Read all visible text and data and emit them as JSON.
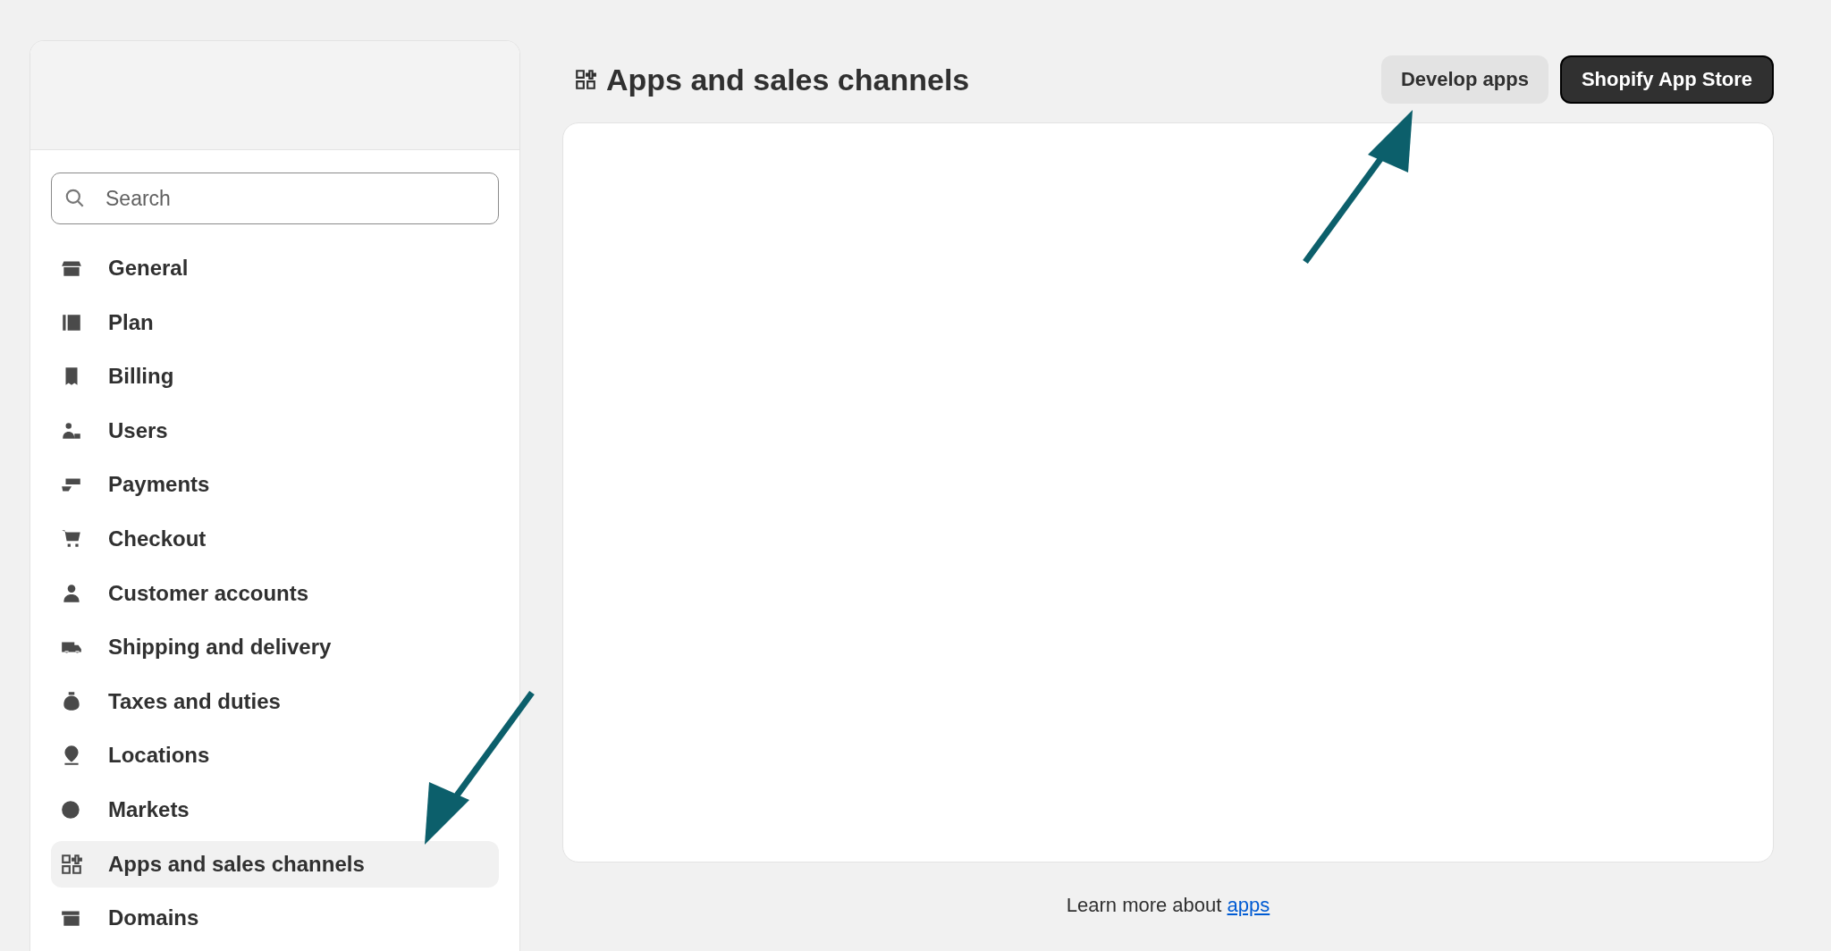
{
  "sidebar": {
    "search": {
      "placeholder": "Search"
    },
    "items": [
      {
        "label": "General",
        "selected": false
      },
      {
        "label": "Plan",
        "selected": false
      },
      {
        "label": "Billing",
        "selected": false
      },
      {
        "label": "Users",
        "selected": false
      },
      {
        "label": "Payments",
        "selected": false
      },
      {
        "label": "Checkout",
        "selected": false
      },
      {
        "label": "Customer accounts",
        "selected": false
      },
      {
        "label": "Shipping and delivery",
        "selected": false
      },
      {
        "label": "Taxes and duties",
        "selected": false
      },
      {
        "label": "Locations",
        "selected": false
      },
      {
        "label": "Markets",
        "selected": false
      },
      {
        "label": "Apps and sales channels",
        "selected": true
      },
      {
        "label": "Domains",
        "selected": false
      }
    ]
  },
  "main": {
    "title": "Apps and sales channels",
    "buttons": [
      {
        "label": "Develop apps",
        "kind": "secondary"
      },
      {
        "label": "Shopify App Store",
        "kind": "primary"
      }
    ],
    "footer": {
      "text": "Learn more about",
      "link": "apps"
    }
  }
}
